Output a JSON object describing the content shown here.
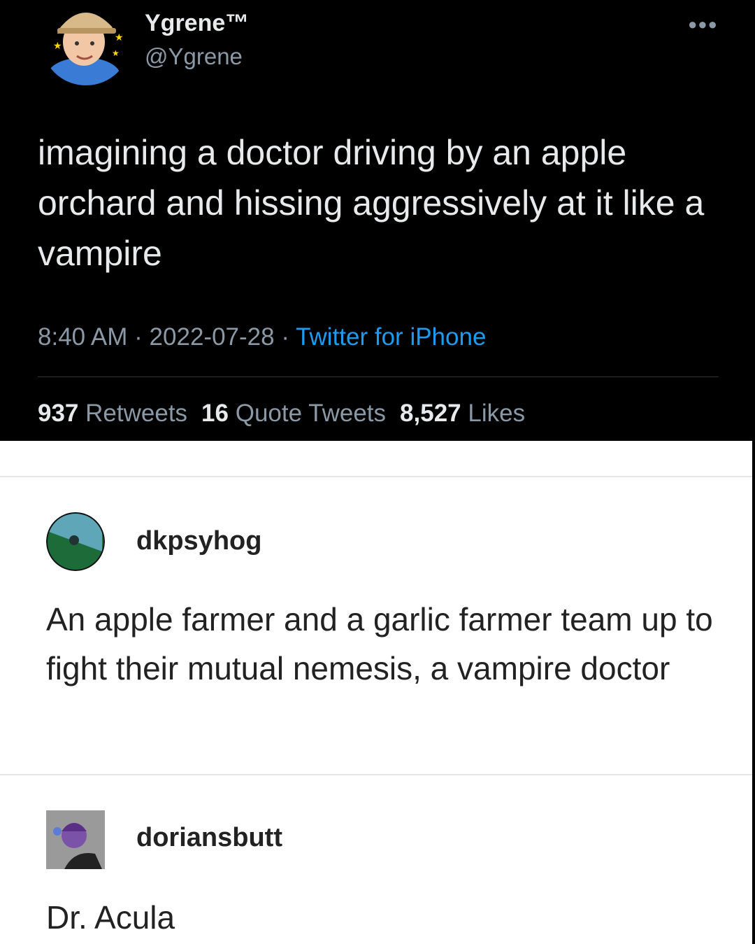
{
  "tweet": {
    "display_name": "Ygrene™",
    "handle": "@Ygrene",
    "more_icon": "more-horizontal-icon",
    "text": "imagining a doctor driving by an apple orchard and hissing aggressively at it like a vampire",
    "time": "8:40 AM",
    "date": "2022-07-28",
    "dot": "·",
    "source": "Twitter for iPhone",
    "retweets_count": "937",
    "retweets_label": "Retweets",
    "quotes_count": "16",
    "quotes_label": "Quote Tweets",
    "likes_count": "8,527",
    "likes_label": "Likes",
    "colors": {
      "background": "#000000",
      "text": "#e7e9ea",
      "muted": "#8b98a5",
      "link": "#1d9bf0"
    }
  },
  "posts": [
    {
      "username": "dkpsyhog",
      "text": "An apple farmer and a garlic farmer team up to fight their mutual nemesis, a vampire doctor"
    },
    {
      "username": "doriansbutt",
      "text": "Dr. Acula"
    }
  ]
}
